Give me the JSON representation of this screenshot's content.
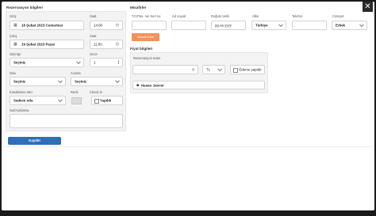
{
  "close_label": "✕",
  "reservation": {
    "title": "Rezervasyon bilgileri",
    "checkin_label": "Giriş",
    "checkin_date": "18 Şubat 2023 Cumartesi",
    "checkin_time_label": "Saat",
    "checkin_time": "14:00",
    "checkout_label": "Çıkış",
    "checkout_date": "19 Şubat 2023 Pazar",
    "checkout_time_label": "Saat",
    "checkout_time": "11:00",
    "room_type_label": "Oda tipi",
    "room_type_value": "Seçiniz",
    "nights_label": "Gece",
    "nights_value": "1",
    "room_label": "Oda",
    "room_value": "Seçiniz",
    "agency_label": "Acente",
    "agency_value": "Seçiniz",
    "board_label": "Konaklama türü",
    "board_value": "Sadece oda",
    "color_label": "Renk",
    "checkin_flag_label": "Check in",
    "checkin_flag_text": "Yapıldı",
    "note_label": "Not/Açıklama",
    "save_label": "Kaydet"
  },
  "guests": {
    "title": "Misafirler",
    "col_id": "T.C/Pas. no/ Seri no",
    "col_name": "Ad soyad",
    "col_birth": "Doğum tarihi",
    "col_country": "Ülke",
    "col_phone": "Telefon",
    "col_gender": "Cinsiyet",
    "birth_placeholder": "gg.aa.yyyy",
    "country_value": "Türkiye",
    "gender_value": "Erkek",
    "add_button": "Misafir Ekle"
  },
  "pricing": {
    "title": "Fiyat bilgileri",
    "total_label": "Rezervasyon tutarı",
    "amount": "0",
    "currency": "TL",
    "payment_label": "Ödeme yapıldı",
    "guest_name": "Hasan Juncer"
  },
  "colors": {
    "accent_orange": "#f2925a",
    "save_blue": "#2f6fb5"
  }
}
